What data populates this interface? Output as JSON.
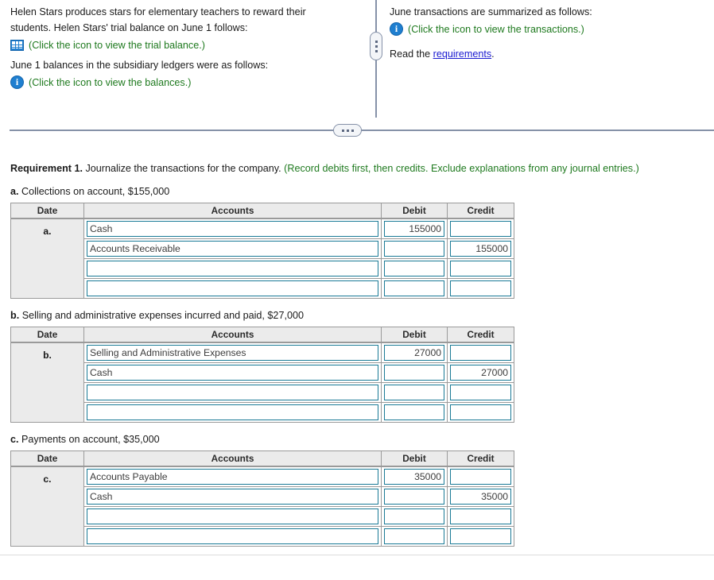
{
  "problem": {
    "left": {
      "intro_line_1": "Helen Stars produces stars for elementary teachers to reward their",
      "intro_line_2": "students. Helen Stars' trial balance on June 1 follows:",
      "trial_balance_hint": "(Click the icon to view the trial balance.)",
      "trial_balance_icon": "table-grid-icon",
      "subsidiary_line": "June 1 balances in the subsidiary ledgers were as follows:",
      "balances_hint": "(Click the icon to view the balances.)",
      "balances_icon": "info-icon"
    },
    "right": {
      "transactions_line": "June transactions are summarized as follows:",
      "transactions_hint": "(Click the icon to view the transactions.)",
      "transactions_icon": "info-icon",
      "read_prefix": "Read the ",
      "read_link": "requirements",
      "read_suffix": ".",
      "link_color": "#1919d0"
    },
    "splitter_handle_glyph": "three-dots"
  },
  "requirement": {
    "label": "Requirement 1.",
    "instruction": " Journalize the transactions for the company. ",
    "note": "(Record debits first, then credits. Exclude explanations from any journal entries.)",
    "note_color": "#1f7a1f"
  },
  "columns": {
    "date": "Date",
    "accounts": "Accounts",
    "debit": "Debit",
    "credit": "Credit"
  },
  "entries": [
    {
      "id": "a",
      "prompt_bold": "a.",
      "prompt_text": " Collections on account, $155,000",
      "date_label": "a.",
      "rows": [
        {
          "account": "Cash",
          "debit": "155000",
          "credit": ""
        },
        {
          "account": "Accounts Receivable",
          "debit": "",
          "credit": "155000"
        },
        {
          "account": "",
          "debit": "",
          "credit": ""
        },
        {
          "account": "",
          "debit": "",
          "credit": ""
        }
      ]
    },
    {
      "id": "b",
      "prompt_bold": "b.",
      "prompt_text": " Selling and administrative expenses incurred and paid, $27,000",
      "date_label": "b.",
      "rows": [
        {
          "account": "Selling and Administrative Expenses",
          "debit": "27000",
          "credit": ""
        },
        {
          "account": "Cash",
          "debit": "",
          "credit": "27000"
        },
        {
          "account": "",
          "debit": "",
          "credit": ""
        },
        {
          "account": "",
          "debit": "",
          "credit": ""
        }
      ]
    },
    {
      "id": "c",
      "prompt_bold": "c.",
      "prompt_text": " Payments on account, $35,000",
      "date_label": "c.",
      "rows": [
        {
          "account": "Accounts Payable",
          "debit": "35000",
          "credit": ""
        },
        {
          "account": "Cash",
          "debit": "",
          "credit": "35000"
        },
        {
          "account": "",
          "debit": "",
          "credit": ""
        },
        {
          "account": "",
          "debit": "",
          "credit": ""
        }
      ]
    }
  ]
}
